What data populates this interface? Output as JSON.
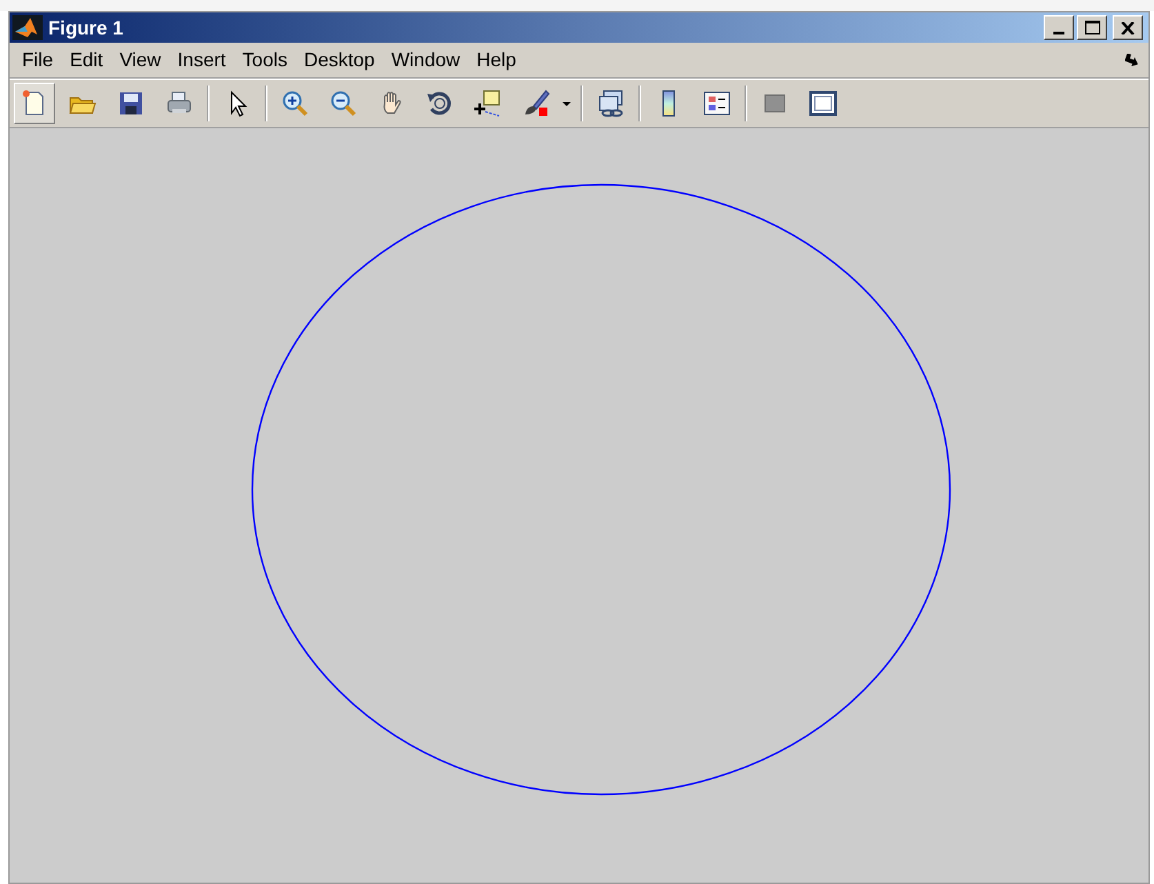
{
  "window": {
    "title": "Figure 1"
  },
  "menu": [
    "File",
    "Edit",
    "View",
    "Insert",
    "Tools",
    "Desktop",
    "Window",
    "Help"
  ],
  "toolbar": [
    {
      "kind": "new",
      "pressed": true
    },
    {
      "kind": "open",
      "pressed": false
    },
    {
      "kind": "save",
      "pressed": false
    },
    {
      "kind": "print",
      "pressed": false
    },
    {
      "kind": "separator"
    },
    {
      "kind": "pointer",
      "pressed": false
    },
    {
      "kind": "separator"
    },
    {
      "kind": "zoom-in",
      "pressed": false
    },
    {
      "kind": "zoom-out",
      "pressed": false
    },
    {
      "kind": "pan",
      "pressed": false
    },
    {
      "kind": "rotate",
      "pressed": false
    },
    {
      "kind": "data-cursor",
      "pressed": false
    },
    {
      "kind": "brush",
      "pressed": false
    },
    {
      "kind": "dropdown"
    },
    {
      "kind": "separator"
    },
    {
      "kind": "link",
      "pressed": false
    },
    {
      "kind": "separator"
    },
    {
      "kind": "colorbar",
      "pressed": false
    },
    {
      "kind": "legend",
      "pressed": false
    },
    {
      "kind": "separator"
    },
    {
      "kind": "hide-tools",
      "pressed": false
    },
    {
      "kind": "show-tools",
      "pressed": false
    }
  ]
}
